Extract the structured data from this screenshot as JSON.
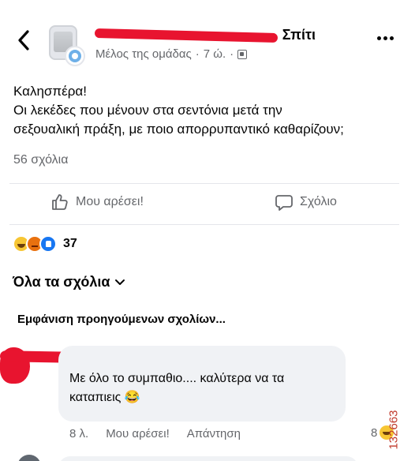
{
  "header": {
    "group_name": "Σπίτι",
    "meta_role": "Μέλος της ομάδας",
    "meta_time": "7 ώ."
  },
  "post": {
    "lines": [
      "Καλησπέρα!",
      "Οι λεκέδες που μένουν στα σεντόνια μετά την",
      "σεξουαλική πράξη, με ποιο απορρυπαντικό καθαρίζουν;"
    ],
    "comments_count": "56 σχόλια"
  },
  "actions": {
    "like_label": "Μου αρέσει!",
    "comment_label": "Σχόλιο"
  },
  "reactions": {
    "count": "37"
  },
  "comments_section": {
    "filter_label": "Όλα τα σχόλια",
    "previous_label": "Εμφάνιση προηγούμενων σχολίων..."
  },
  "comment": {
    "text_line1": "Με όλο το συμπαθιο.... καλύτερα να τα",
    "text_line2": "καταπιεις 😂",
    "time": "8 λ.",
    "like_label": "Μου αρέσει!",
    "reply_label": "Απάντηση",
    "reaction_count": "8"
  },
  "watermark": "132663",
  "colors": {
    "redaction": "#e8142f",
    "text_primary": "#050505",
    "text_secondary": "#65676b",
    "bubble": "#f0f2f5"
  }
}
